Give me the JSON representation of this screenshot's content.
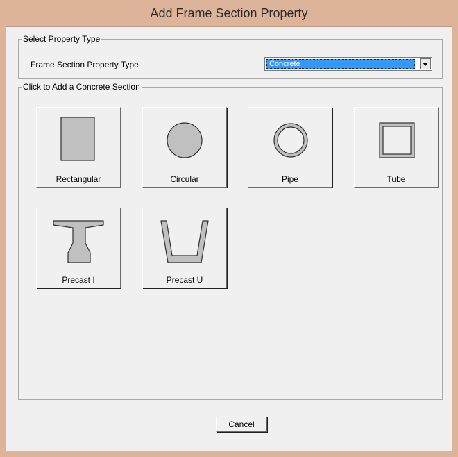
{
  "window": {
    "title": "Add Frame Section Property"
  },
  "property_type_group": {
    "legend": "Select Property Type",
    "field_label": "Frame Section Property Type",
    "selected_value": "Concrete"
  },
  "sections_group": {
    "legend": "Click to Add a Concrete Section",
    "buttons": [
      {
        "label": "Rectangular",
        "icon": "rectangular-section-icon"
      },
      {
        "label": "Circular",
        "icon": "circular-section-icon"
      },
      {
        "label": "Pipe",
        "icon": "pipe-section-icon"
      },
      {
        "label": "Tube",
        "icon": "tube-section-icon"
      },
      {
        "label": "Precast I",
        "icon": "precast-i-section-icon"
      },
      {
        "label": "Precast U",
        "icon": "precast-u-section-icon"
      }
    ]
  },
  "footer": {
    "cancel_label": "Cancel"
  },
  "colors": {
    "title_bar": "#ddb49a",
    "selection": "#3399ff",
    "shape_fill": "#c0c0c0"
  }
}
